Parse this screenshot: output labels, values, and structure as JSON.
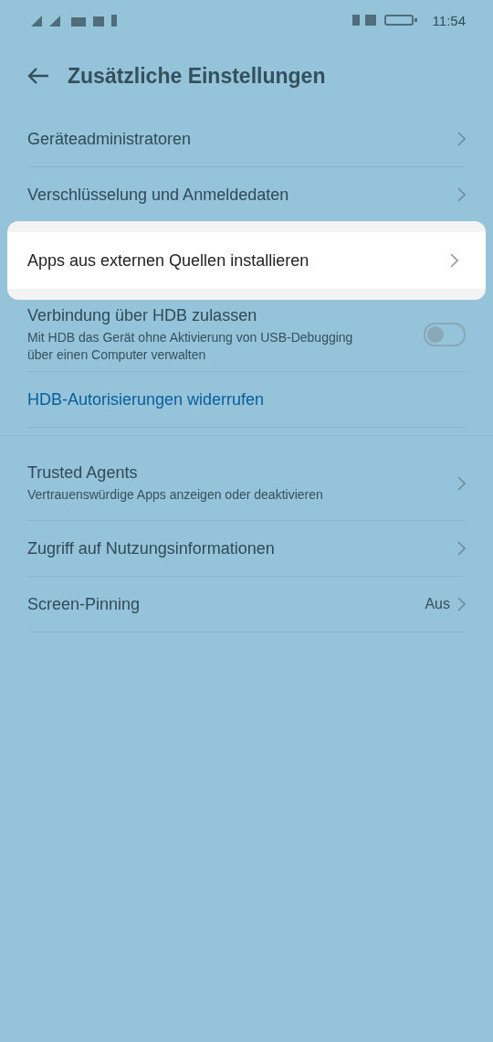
{
  "status_bar": {
    "time": "11:54"
  },
  "header": {
    "title": "Zusätzliche Einstellungen"
  },
  "items": [
    {
      "kind": "nav",
      "title": "Geräteadministratoren",
      "highlighted": false
    },
    {
      "kind": "nav",
      "title": "Verschlüsselung und Anmeldedaten",
      "highlighted": false
    },
    {
      "kind": "nav",
      "title": "Apps aus externen Quellen installieren",
      "highlighted": true
    },
    {
      "kind": "toggle",
      "title": "Verbindung über HDB zulassen",
      "subtitle": "Mit HDB das Gerät ohne Aktivierung von USB-Debugging über einen Computer verwalten",
      "on": false,
      "highlighted": false
    },
    {
      "kind": "link",
      "title": "HDB-Autorisierungen widerrufen",
      "highlighted": false
    },
    {
      "kind": "gap"
    },
    {
      "kind": "nav",
      "title": "Trusted Agents",
      "subtitle": "Vertrauenswürdige Apps anzeigen oder deaktivieren",
      "highlighted": false
    },
    {
      "kind": "nav",
      "title": "Zugriff auf Nutzungsinformationen",
      "highlighted": false
    },
    {
      "kind": "nav",
      "title": "Screen-Pinning",
      "value": "Aus",
      "highlighted": false
    }
  ]
}
